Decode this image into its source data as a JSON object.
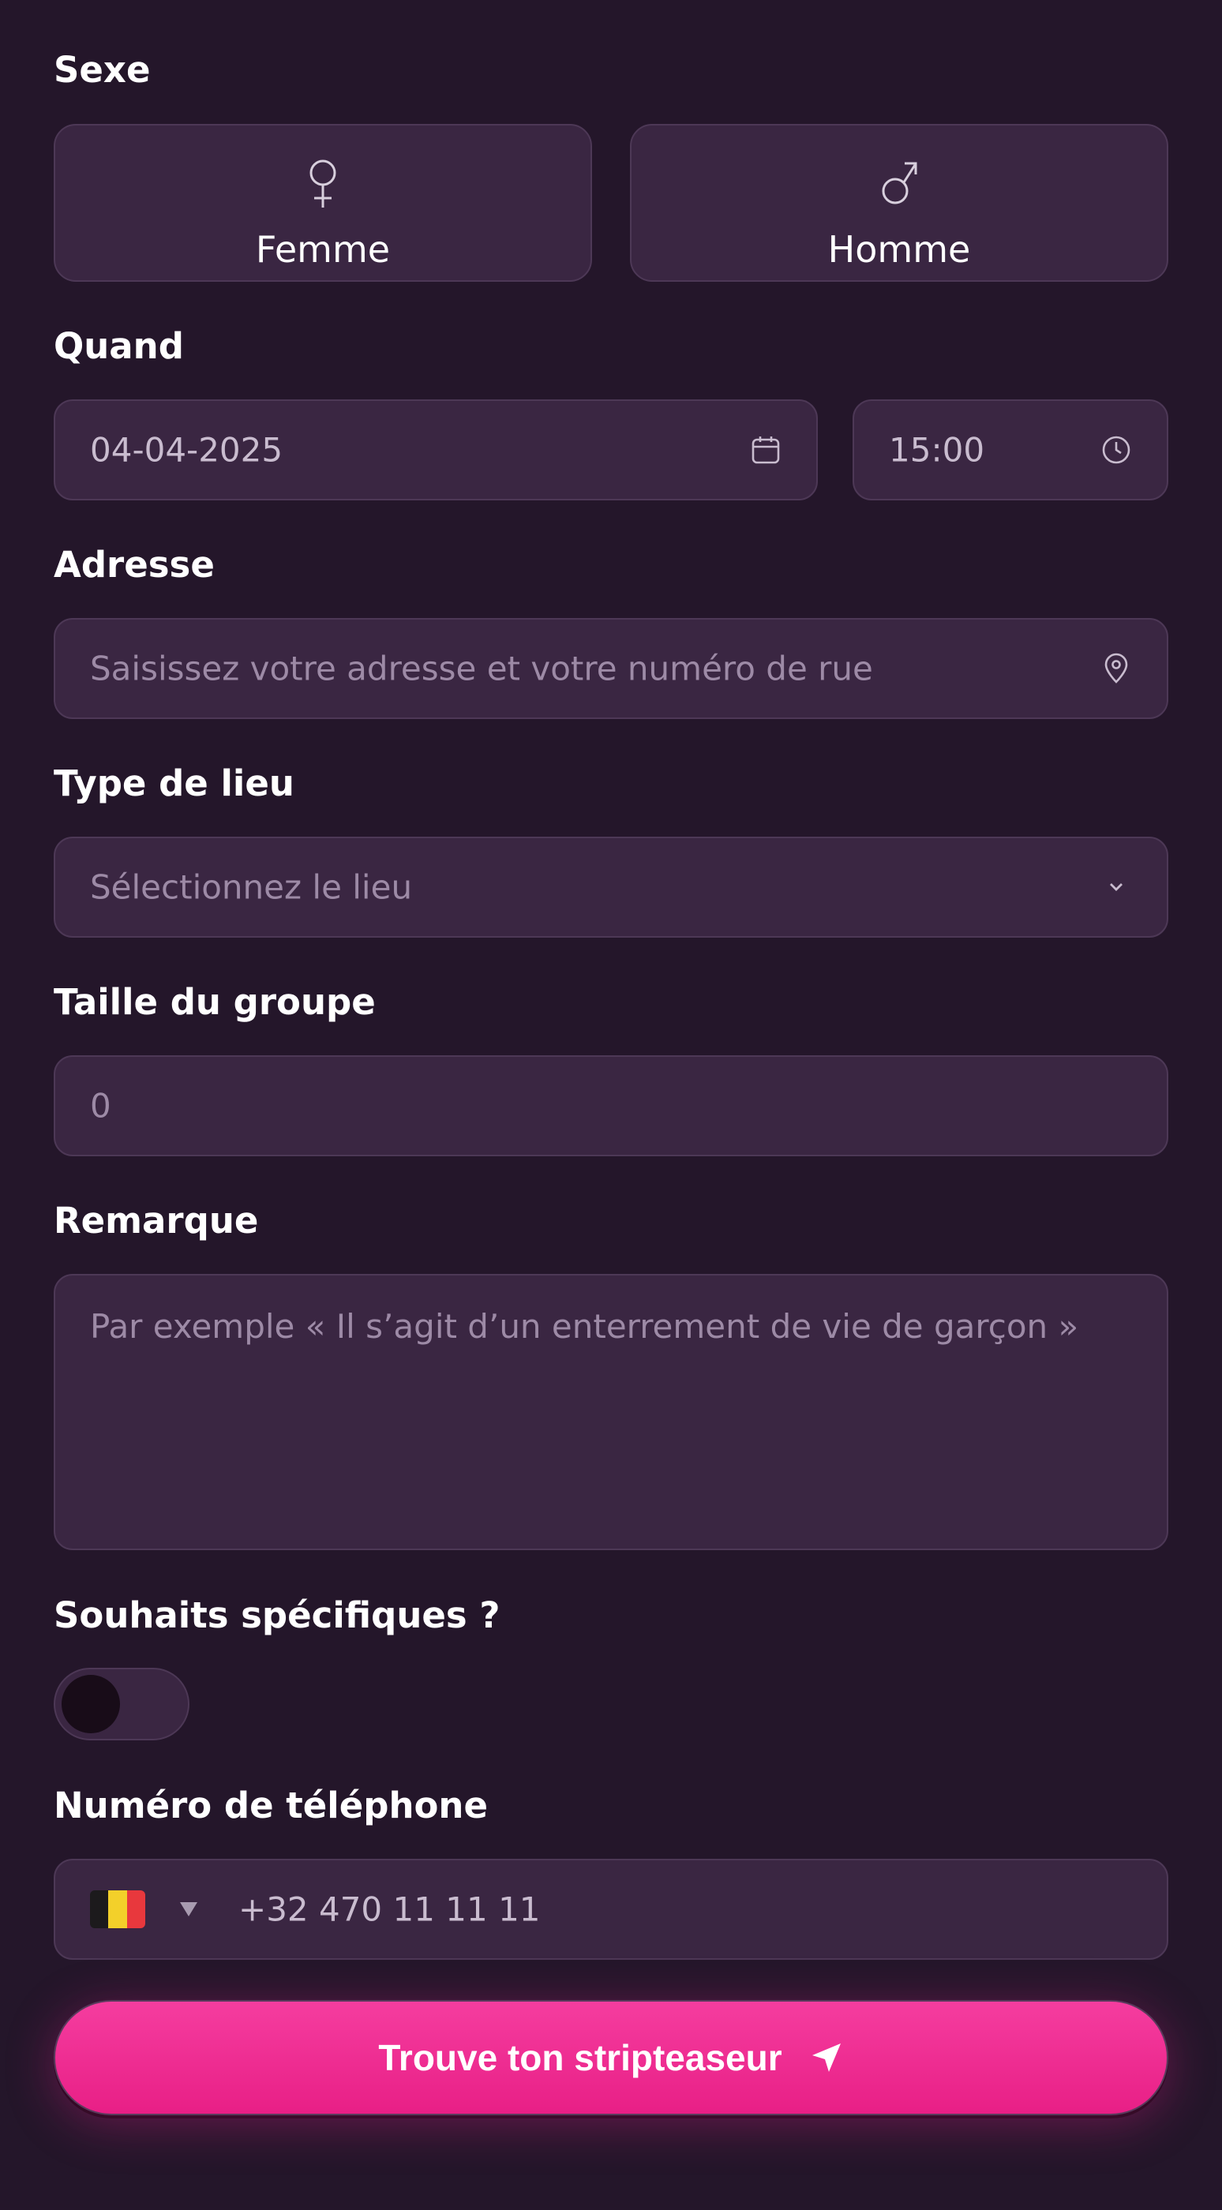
{
  "gender": {
    "label": "Sexe",
    "options": [
      {
        "label": "Femme",
        "symbol": "female-symbol"
      },
      {
        "label": "Homme",
        "symbol": "male-symbol"
      }
    ]
  },
  "when": {
    "label": "Quand",
    "date_value": "04-04-2025",
    "time_value": "15:00"
  },
  "address": {
    "label": "Adresse",
    "placeholder": "Saisissez votre adresse et votre numéro de rue"
  },
  "venue_type": {
    "label": "Type de lieu",
    "placeholder": "Sélectionnez le lieu"
  },
  "group_size": {
    "label": "Taille du groupe",
    "placeholder": "0"
  },
  "remark": {
    "label": "Remarque",
    "placeholder": "Par exemple « Il s’agit d’un enterrement de vie de garçon »"
  },
  "special_wishes": {
    "label": "Souhaits spécifiques ?",
    "enabled": false
  },
  "phone": {
    "label": "Numéro de téléphone",
    "country_flag": "belgium-flag",
    "placeholder": "+32 470 11 11 11"
  },
  "submit": {
    "label": "Trouve ton stripteaseur",
    "icon": "send-icon"
  },
  "colors": {
    "background": "#24162a",
    "field": "#3a2642",
    "accent": "#ef2d91"
  }
}
